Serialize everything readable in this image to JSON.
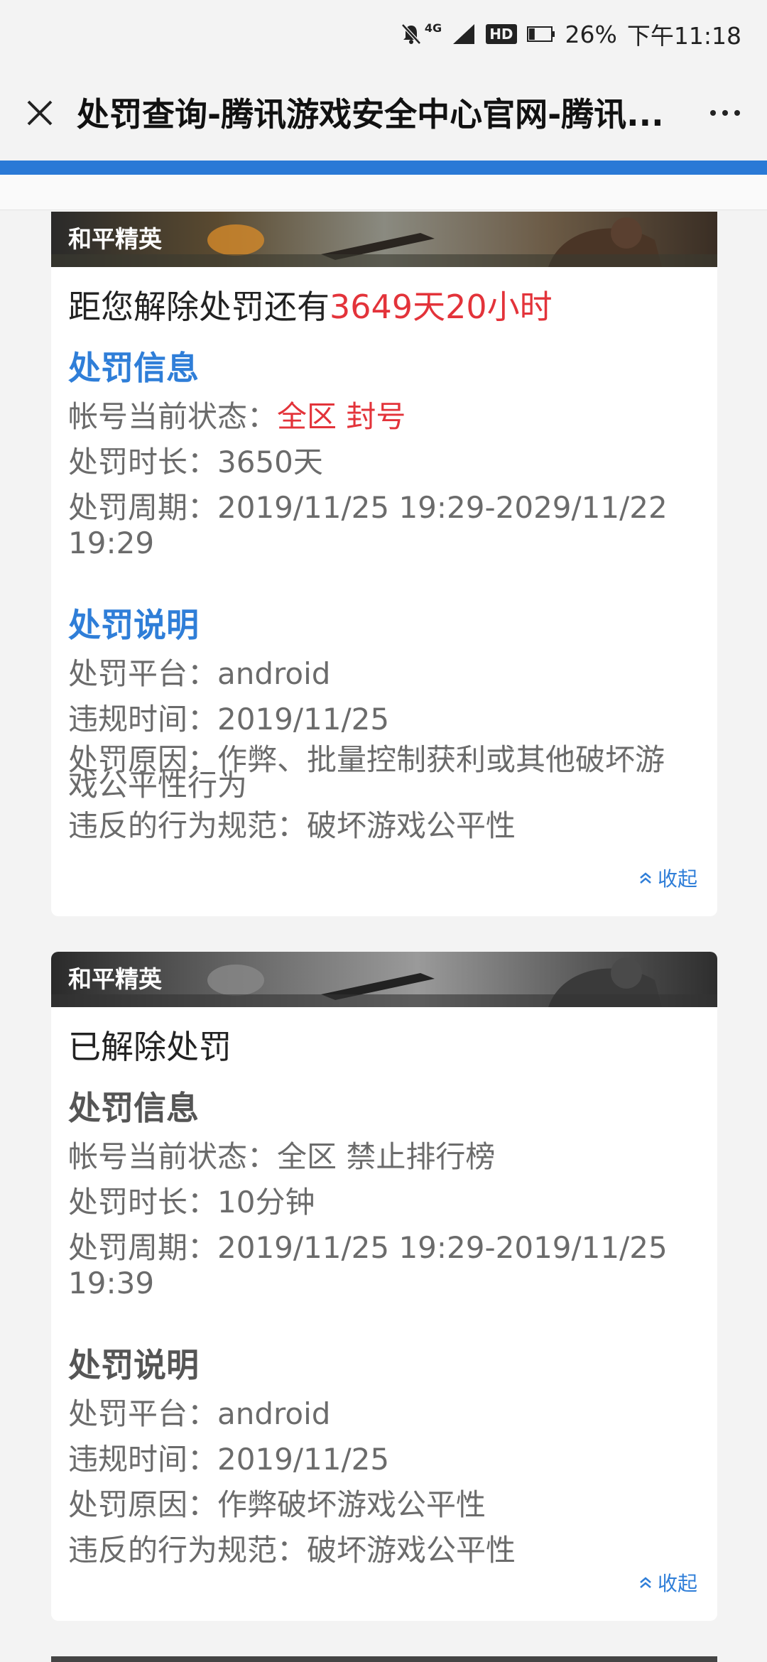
{
  "status_bar": {
    "network": "4G",
    "hd": "HD",
    "battery": "26%",
    "time": "下午11:18",
    "battery_level": 0.26
  },
  "title_bar": {
    "title": "处罚查询-腾讯游戏安全中心官网-腾讯..."
  },
  "cards": [
    {
      "game": "和平精英",
      "status": "距您解除处罚还有",
      "countdown": "3649天20小时",
      "info_title": "处罚信息",
      "state_label": "帐号当前状态：",
      "state_value": "全区 封号",
      "duration_label": "处罚时长：",
      "duration_value": "3650天",
      "period_label": "处罚周期：",
      "period_value": "2019/11/25 19:29-2029/11/22 19:29",
      "desc_title": "处罚说明",
      "platform_label": "处罚平台：",
      "platform_value": "android",
      "violation_time_label": "违规时间：",
      "violation_time_value": "2019/11/25",
      "reason_label": "处罚原因：",
      "reason_value": "作弊、批量控制获利或其他破坏游戏公平性行为",
      "rule_label": "违反的行为规范：",
      "rule_value": "破坏游戏公平性",
      "collapse": "收起"
    },
    {
      "game": "和平精英",
      "status": "已解除处罚",
      "info_title": "处罚信息",
      "state_label": "帐号当前状态：",
      "state_value": "全区 禁止排行榜",
      "duration_label": "处罚时长：",
      "duration_value": "10分钟",
      "period_label": "处罚周期：",
      "period_value": "2019/11/25 19:29-2019/11/25 19:39",
      "desc_title": "处罚说明",
      "platform_label": "处罚平台：",
      "platform_value": "android",
      "violation_time_label": "违规时间：",
      "violation_time_value": "2019/11/25",
      "reason_label": "处罚原因：",
      "reason_value": "作弊破坏游戏公平性",
      "rule_label": "违反的行为规范：",
      "rule_value": "破坏游戏公平性",
      "collapse": "收起"
    }
  ],
  "colors": {
    "accent_blue": "#2f7ed8",
    "progress_blue": "#2a79d6",
    "alert_red": "#e3333a"
  }
}
